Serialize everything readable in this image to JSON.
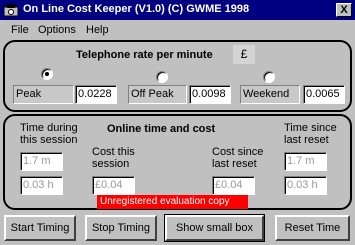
{
  "window": {
    "title": "On Line Cost Keeper (V1.0) (C) GWME 1998",
    "close_glyph": "X",
    "icon": "phone-app-icon"
  },
  "menu": [
    "File",
    "Options",
    "Help"
  ],
  "rates": {
    "heading": "Telephone rate per minute",
    "currency_symbol": "£",
    "items": [
      {
        "label": "Peak",
        "value": "0.0228",
        "selected": true
      },
      {
        "label": "Off Peak",
        "value": "0.0098",
        "selected": false
      },
      {
        "label": "Weekend",
        "value": "0.0065",
        "selected": false
      }
    ]
  },
  "stats": {
    "heading": "Online time and cost",
    "session_time_label_1": "Time during",
    "session_time_label_2": "this session",
    "session_cost_label_1": "Cost this",
    "session_cost_label_2": "session",
    "reset_cost_label_1": "Cost since",
    "reset_cost_label_2": "last reset",
    "reset_time_label_1": "Time since",
    "reset_time_label_2": "last reset",
    "session_minutes": "1.7 m",
    "session_hours": "0.03 h",
    "session_cost": "£0.04",
    "reset_cost": "£0.04",
    "reset_minutes": "1.7 m",
    "reset_hours": "0.03 h"
  },
  "notice": "Unregistered evaluation copy",
  "buttons": {
    "start": "Start Timing",
    "stop": "Stop Timing",
    "small_box": "Show small box",
    "reset": "Reset Time"
  }
}
